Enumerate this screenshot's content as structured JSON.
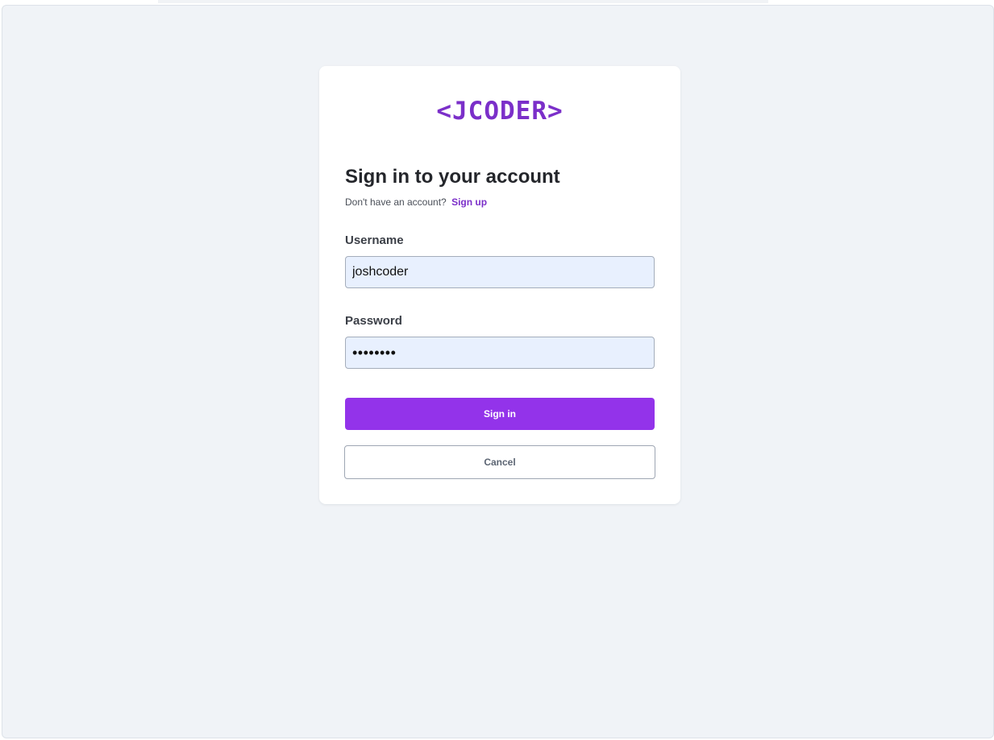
{
  "logo": {
    "text": "<JCODER>"
  },
  "form": {
    "heading": "Sign in to your account",
    "signup_prompt": "Don't have an account?",
    "signup_link": "Sign up",
    "username_label": "Username",
    "username_value": "joshcoder",
    "password_label": "Password",
    "password_value": "••••••••",
    "signin_button": "Sign in",
    "cancel_button": "Cancel"
  },
  "colors": {
    "brand": "#7b2fc9",
    "primary_button": "#9333ea",
    "page_background": "#f0f3f7",
    "input_background": "#e8f0fe"
  }
}
